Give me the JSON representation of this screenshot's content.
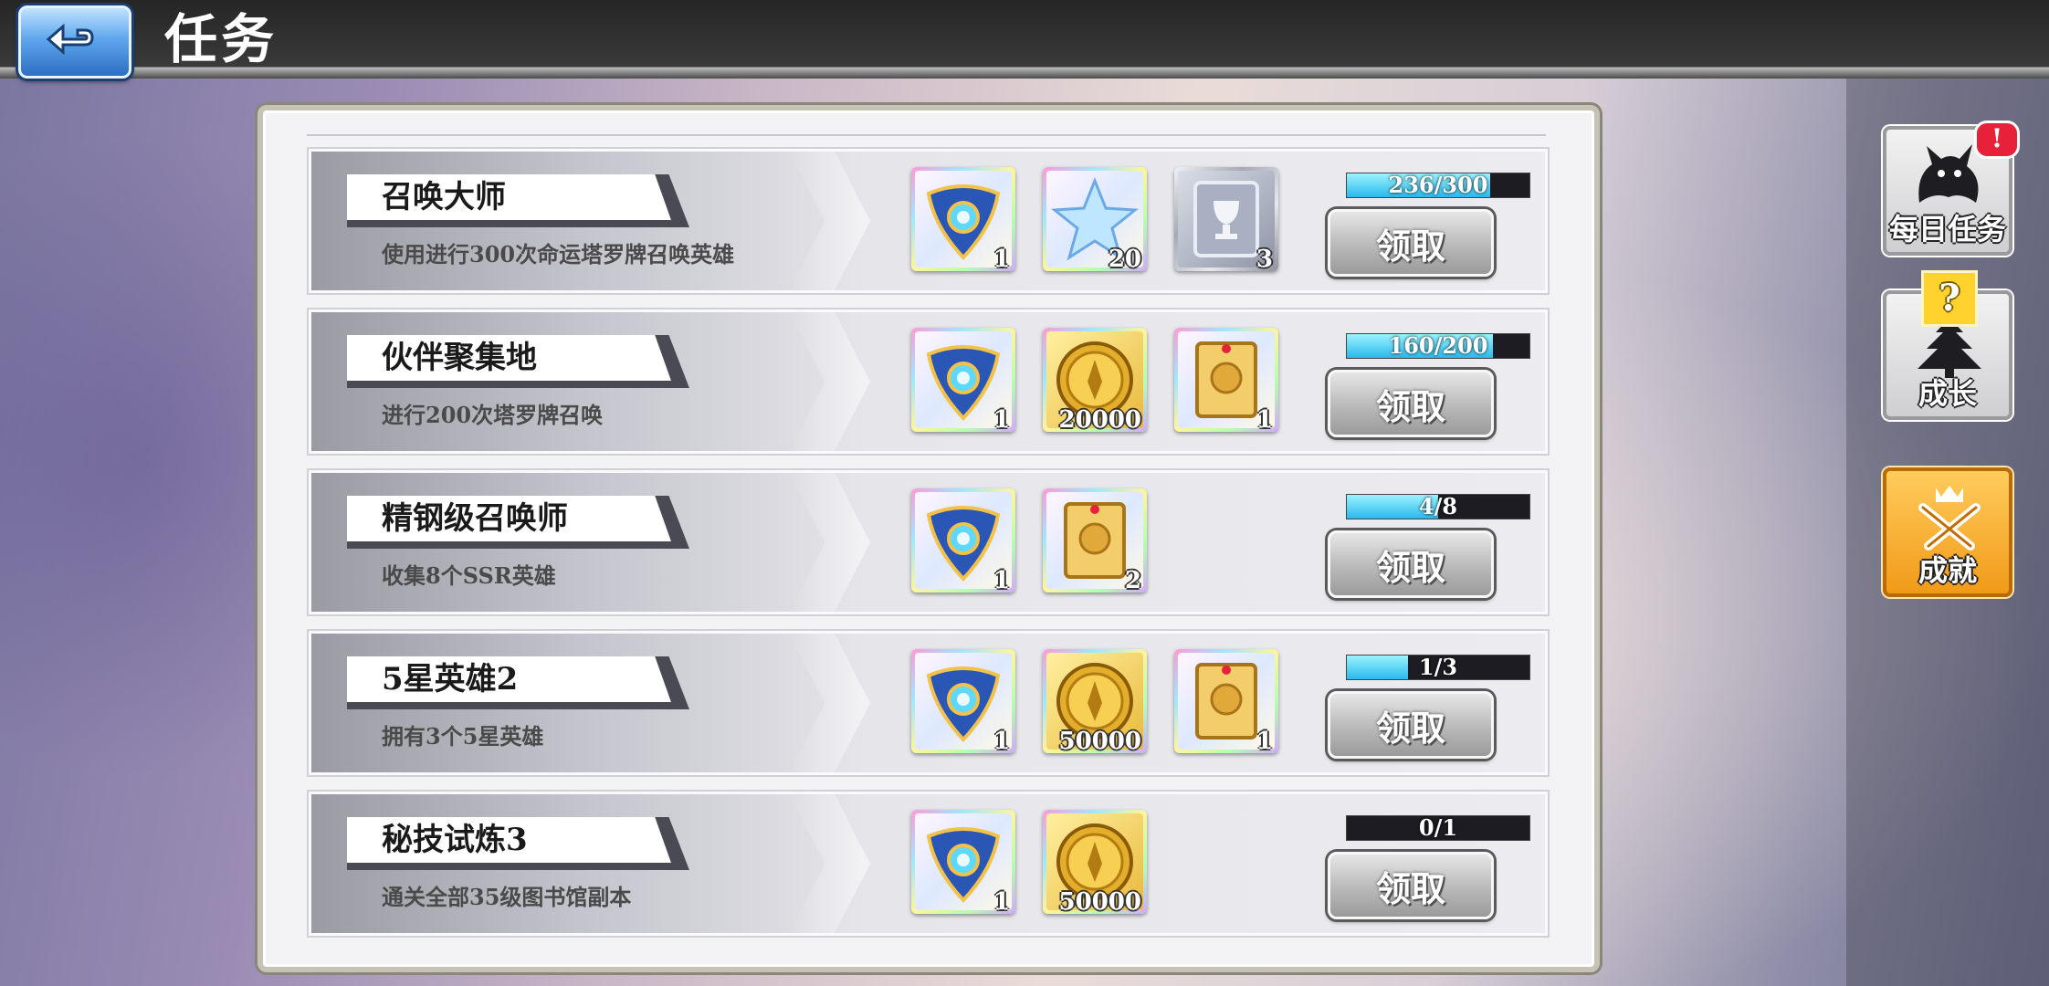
{
  "header": {
    "title": "任务"
  },
  "tasks": [
    {
      "name": "召唤大师",
      "desc": "使用进行300次命运塔罗牌召唤英雄",
      "progress_text": "236/300",
      "progress": 0.787,
      "rewards": [
        {
          "icon": "gear-shield-icon",
          "count": "1",
          "frame": "rainbow"
        },
        {
          "icon": "star-icon",
          "count": "20",
          "frame": "rainbow"
        },
        {
          "icon": "trophy-card-icon",
          "count": "3",
          "frame": "silver"
        }
      ],
      "button": "领取"
    },
    {
      "name": "伙伴聚集地",
      "desc": "进行200次塔罗牌召唤",
      "progress_text": "160/200",
      "progress": 0.8,
      "rewards": [
        {
          "icon": "gear-shield-icon",
          "count": "1",
          "frame": "rainbow"
        },
        {
          "icon": "gold-coin-icon",
          "count": "20000",
          "frame": "gold"
        },
        {
          "icon": "gold-card-icon",
          "count": "1",
          "frame": "rainbow"
        }
      ],
      "button": "领取"
    },
    {
      "name": "精钢级召唤师",
      "desc": "收集8个SSR英雄",
      "progress_text": "4/8",
      "progress": 0.5,
      "rewards": [
        {
          "icon": "gear-shield-icon",
          "count": "1",
          "frame": "rainbow"
        },
        {
          "icon": "gold-card-icon",
          "count": "2",
          "frame": "rainbow"
        }
      ],
      "button": "领取"
    },
    {
      "name": "5星英雄2",
      "desc": "拥有3个5星英雄",
      "progress_text": "1/3",
      "progress": 0.333,
      "rewards": [
        {
          "icon": "gear-shield-icon",
          "count": "1",
          "frame": "rainbow"
        },
        {
          "icon": "gold-coin-icon",
          "count": "50000",
          "frame": "gold"
        },
        {
          "icon": "gold-card-icon",
          "count": "1",
          "frame": "rainbow"
        }
      ],
      "button": "领取"
    },
    {
      "name": "秘技试炼3",
      "desc": "通关全部35级图书馆副本",
      "progress_text": "0/1",
      "progress": 0,
      "rewards": [
        {
          "icon": "gear-shield-icon",
          "count": "1",
          "frame": "rainbow"
        },
        {
          "icon": "gold-coin-icon",
          "count": "50000",
          "frame": "gold"
        }
      ],
      "button": "领取"
    }
  ],
  "side_tabs": [
    {
      "label": "每日任务",
      "badge": "!",
      "style": "gray"
    },
    {
      "label": "成长",
      "badge": "?",
      "style": "gray"
    },
    {
      "label": "成就",
      "badge": "",
      "style": "orange"
    }
  ],
  "colors": {
    "progress_fill": "#2ab8ec",
    "side_active": "#f19a18"
  }
}
